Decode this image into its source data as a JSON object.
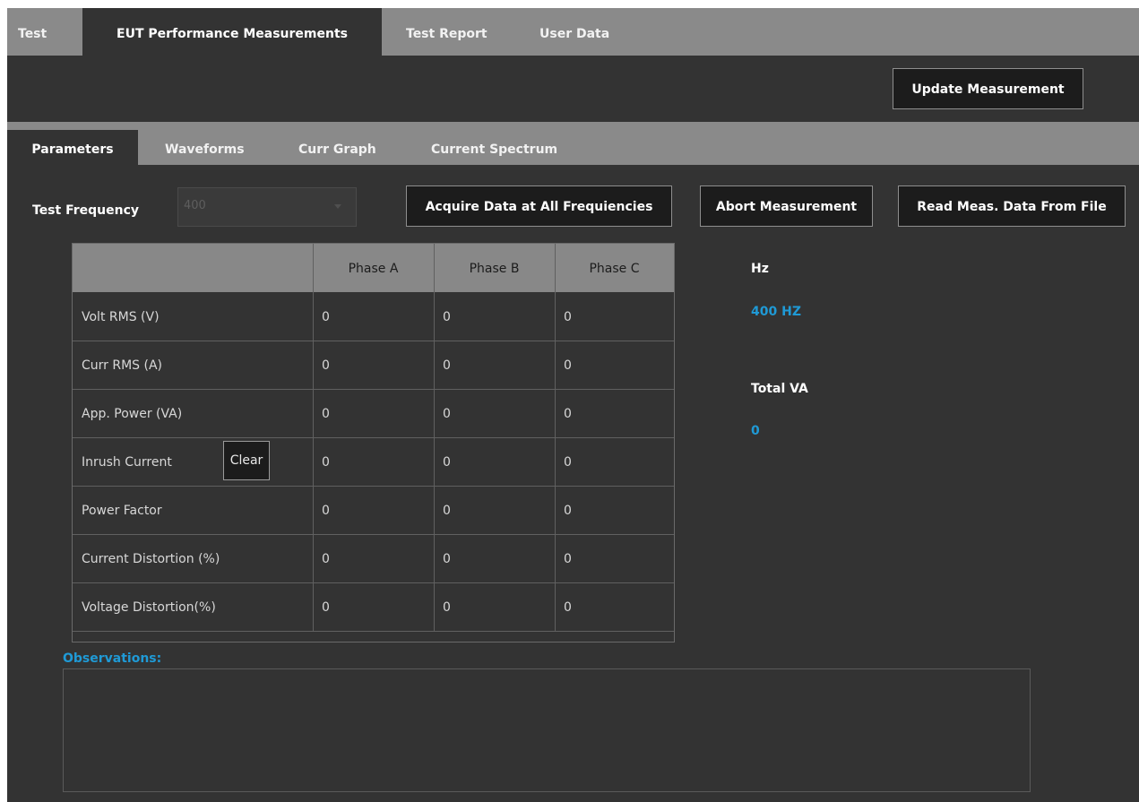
{
  "top_tabs": [
    {
      "label": "Test"
    },
    {
      "label": "EUT Performance Measurements"
    },
    {
      "label": "Test Report"
    },
    {
      "label": "User Data"
    }
  ],
  "header": {
    "update_button": "Update Measurement"
  },
  "sub_tabs": [
    {
      "label": "Parameters"
    },
    {
      "label": "Waveforms"
    },
    {
      "label": "Curr Graph"
    },
    {
      "label": "Current Spectrum"
    }
  ],
  "controls": {
    "test_frequency_label": "Test Frequency",
    "test_frequency_value": "400",
    "acquire_button": "Acquire Data at All Frequiencies",
    "abort_button": "Abort Measurement",
    "read_button": "Read Meas. Data From File"
  },
  "table": {
    "columns": [
      "",
      "Phase A",
      "Phase B",
      "Phase C"
    ],
    "rows": [
      {
        "label": "Volt RMS (V)",
        "values": [
          "0",
          "0",
          "0"
        ]
      },
      {
        "label": "Curr RMS (A)",
        "values": [
          "0",
          "0",
          "0"
        ]
      },
      {
        "label": "App. Power (VA)",
        "values": [
          "0",
          "0",
          "0"
        ]
      },
      {
        "label": "Inrush Current",
        "values": [
          "0",
          "0",
          "0"
        ]
      },
      {
        "label": "Power Factor",
        "values": [
          "0",
          "0",
          "0"
        ]
      },
      {
        "label": "Current Distortion (%)",
        "values": [
          "0",
          "0",
          "0"
        ]
      },
      {
        "label": "Voltage Distortion(%)",
        "values": [
          "0",
          "0",
          "0"
        ]
      }
    ],
    "clear_button": "Clear"
  },
  "info": {
    "hz_label": "Hz",
    "hz_value": "400 HZ",
    "total_va_label": "Total VA",
    "total_va_value": "0"
  },
  "observations": {
    "label": "Observations:",
    "text": ""
  },
  "colors": {
    "background": "#333333",
    "tab_bar": "#8a8a8a",
    "accent_blue": "#1f9ad6",
    "button_bg": "#1c1c1c"
  }
}
